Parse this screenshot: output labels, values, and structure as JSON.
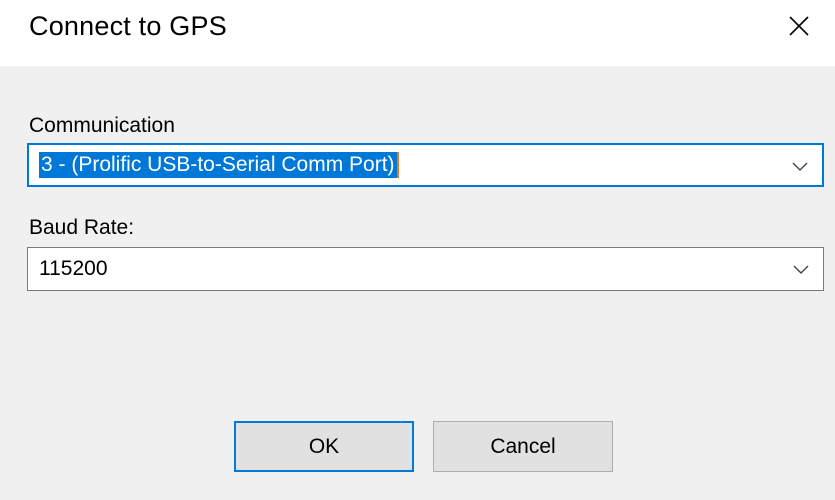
{
  "window": {
    "title": "Connect to GPS",
    "close_icon": "close-icon"
  },
  "communication": {
    "label": "Communication",
    "selected": "3 - (Prolific USB-to-Serial Comm Port)",
    "dropdown_icon": "chevron-down-icon"
  },
  "baud_rate": {
    "label": "Baud Rate:",
    "selected": "115200",
    "dropdown_icon": "chevron-down-icon"
  },
  "buttons": {
    "ok_label": "OK",
    "cancel_label": "Cancel"
  },
  "colors": {
    "accent": "#0078d7",
    "selection_bg": "#0078d7",
    "caret": "#e6791f",
    "client_bg": "#f0f0f0",
    "button_bg": "#e1e1e1"
  }
}
